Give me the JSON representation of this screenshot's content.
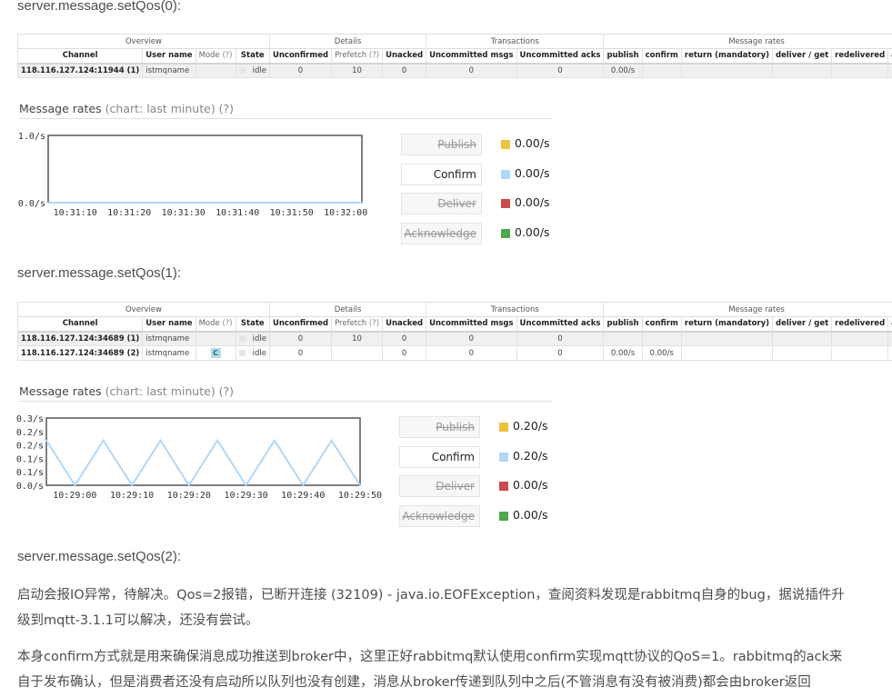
{
  "headings": {
    "h0": "server.message.setQos(0):",
    "h1": "server.message.setQos(1):",
    "h2": "server.message.setQos(2):"
  },
  "table": {
    "groups": {
      "overview": "Overview",
      "details": "Details",
      "transactions": "Transactions",
      "rates": "Message rates"
    },
    "columns": {
      "channel": "Channel",
      "user": "User name",
      "mode": "Mode",
      "help": "(?)",
      "state": "State",
      "unconfirmed": "Unconfirmed",
      "prefetch": "Prefetch",
      "unacked": "Unacked",
      "uncommitted_msgs": "Uncommitted msgs",
      "uncommitted_acks": "Uncommitted acks",
      "publish": "publish",
      "confirm": "confirm",
      "return": "return (mandatory)",
      "deliver": "deliver / get",
      "redelivered": "redelivered",
      "ack": "ack"
    }
  },
  "table0": {
    "rows": [
      {
        "channel": "118.116.127.124:11944 (1)",
        "user": "istmqname",
        "mode": "",
        "state": "idle",
        "unconfirmed": "0",
        "prefetch": "10",
        "unacked": "0",
        "uncommitted_msgs": "0",
        "uncommitted_acks": "0",
        "publish": "0.00/s",
        "confirm": "",
        "return": "",
        "deliver": "",
        "redelivered": "",
        "ack": ""
      }
    ]
  },
  "table1": {
    "rows": [
      {
        "channel": "118.116.127.124:34689 (1)",
        "user": "istmqname",
        "mode": "",
        "state": "idle",
        "unconfirmed": "0",
        "prefetch": "10",
        "unacked": "0",
        "uncommitted_msgs": "0",
        "uncommitted_acks": "0",
        "publish": "",
        "confirm": "",
        "return": "",
        "deliver": "",
        "redelivered": "",
        "ack": ""
      },
      {
        "channel": "118.116.127.124:34689 (2)",
        "user": "istmqname",
        "mode": "C",
        "state": "idle",
        "unconfirmed": "0",
        "prefetch": "",
        "unacked": "0",
        "uncommitted_msgs": "0",
        "uncommitted_acks": "0",
        "publish": "0.00/s",
        "confirm": "0.00/s",
        "return": "",
        "deliver": "",
        "redelivered": "",
        "ack": ""
      }
    ]
  },
  "message_rates": {
    "title": "Message rates",
    "subtitle": "(chart: last minute) (?)"
  },
  "legend0": {
    "items": [
      {
        "label": "Publish",
        "value": "0.00/s",
        "color": "#edc240",
        "enabled": false
      },
      {
        "label": "Confirm",
        "value": "0.00/s",
        "color": "#afd8f8",
        "enabled": true
      },
      {
        "label": "Deliver",
        "value": "0.00/s",
        "color": "#cb4b4b",
        "enabled": false
      },
      {
        "label": "Acknowledge",
        "value": "0.00/s",
        "color": "#4da74d",
        "enabled": false
      }
    ]
  },
  "legend1": {
    "items": [
      {
        "label": "Publish",
        "value": "0.20/s",
        "color": "#edc240",
        "enabled": false
      },
      {
        "label": "Confirm",
        "value": "0.20/s",
        "color": "#afd8f8",
        "enabled": true
      },
      {
        "label": "Deliver",
        "value": "0.00/s",
        "color": "#cb4b4b",
        "enabled": false
      },
      {
        "label": "Acknowledge",
        "value": "0.00/s",
        "color": "#4da74d",
        "enabled": false
      }
    ]
  },
  "chart_data": [
    {
      "type": "line",
      "title": "",
      "x": [
        "10:31:05",
        "10:31:10",
        "10:31:20",
        "10:31:30",
        "10:31:40",
        "10:31:50",
        "10:32:00",
        "10:32:03"
      ],
      "x_tick_labels": [
        "10:31:10",
        "10:31:20",
        "10:31:30",
        "10:31:40",
        "10:31:50",
        "10:32:00"
      ],
      "y_tick_labels": [
        "1.0/s",
        "0.0/s"
      ],
      "ylim": [
        0,
        1
      ],
      "series": [
        {
          "values": [
            0,
            0,
            0,
            0,
            0,
            0,
            0,
            0
          ],
          "color": "#afd8f8"
        }
      ],
      "grid": false
    },
    {
      "type": "line",
      "title": "",
      "x": [
        "10:28:55",
        "10:29:00",
        "10:29:05",
        "10:29:10",
        "10:29:15",
        "10:29:20",
        "10:29:25",
        "10:29:30",
        "10:29:35",
        "10:29:40",
        "10:29:45",
        "10:29:50"
      ],
      "x_tick_labels": [
        "10:29:00",
        "10:29:10",
        "10:29:20",
        "10:29:30",
        "10:29:40",
        "10:29:50"
      ],
      "y_tick_labels": [
        "0.3/s",
        "0.2/s",
        "0.2/s",
        "0.1/s",
        "0.1/s",
        "0.0/s"
      ],
      "ylim": [
        0,
        0.3
      ],
      "series": [
        {
          "values": [
            0.2,
            0,
            0.2,
            0,
            0.2,
            0,
            0.2,
            0,
            0.2,
            0,
            0.2,
            0
          ],
          "color": "#afd8f8"
        }
      ],
      "grid": false
    }
  ],
  "paragraphs": {
    "p1_line1": "启动会报IO异常，待解决。Qos=2报错，已断开连接 (32109) - java.io.EOFException，查阅资料发现是rabbitmq自身的bug，据说插件升",
    "p1_line2": "级到mqtt-3.1.1可以解决，还没有尝试。",
    "p2_line1": "本身confirm方式就是用来确保消息成功推送到broker中，这里正好rabbitmq默认使用confirm实现mqtt协议的QoS=1。rabbitmq的ack来",
    "p2_line2": "自于发布确认，但是消费者还没有启动所以队列也没有创建，消息从broker传递到队列中之后(不管消息有没有被消费)都会由broker返回"
  }
}
